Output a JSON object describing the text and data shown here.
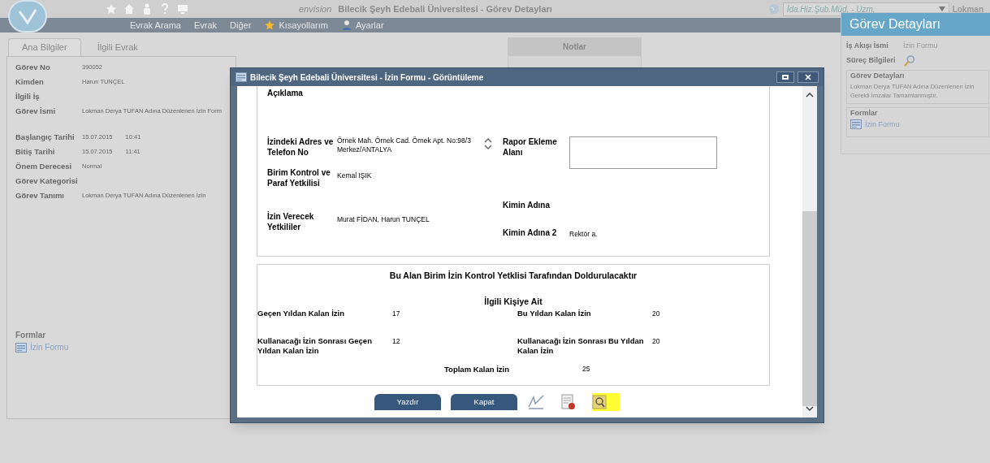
{
  "app": {
    "title": "Bilecik Şeyh Edebali Üniversitesi - Görev Detayları",
    "brand": "envision",
    "role": "İda.Hiz.Şub.Müd. - Uzm.",
    "user": "Lokman"
  },
  "menu": [
    {
      "label": "Evrak Arama",
      "kind": "plain"
    },
    {
      "label": "Evrak",
      "kind": "plain"
    },
    {
      "label": "Diğer",
      "kind": "plain"
    },
    {
      "label": "Kısayollarım",
      "kind": "star"
    },
    {
      "label": "Ayarlar",
      "kind": "user"
    }
  ],
  "tabs": [
    {
      "label": "Ana Bilgiler",
      "selected": true
    },
    {
      "label": "İlgili Evrak",
      "selected": false
    }
  ],
  "field_groups": [
    [
      {
        "label": "Görev No",
        "value": "390052"
      },
      {
        "label": "Kimden",
        "value": "Harun TUNÇEL"
      },
      {
        "label": "İlgili İş"
      },
      {
        "label": "Görev İsmi",
        "value": "Lokman Derya TUFAN Adına Düzenlenen İzin Form"
      }
    ],
    [
      {
        "label": "Başlangıç Tarihi",
        "value": "15.07.2015",
        "time": "10:41"
      },
      {
        "label": "Bitiş Tarihi",
        "value": "15.07.2015",
        "time": "11:41"
      },
      {
        "label": "Önem Derecesi",
        "value": "Normal"
      },
      {
        "label": "Görev Kategorisi"
      },
      {
        "label": "Görev Tanımı",
        "value": "Lokman Derya TUFAN Adına Düzenlenen İzin"
      }
    ]
  ],
  "forms": {
    "title": "Formlar",
    "items": [
      "İzin Formu"
    ]
  },
  "notes": {
    "title": "Notlar"
  },
  "side_panel": {
    "title": "Görev Detayları",
    "rows": [
      {
        "label": "İş Akışı İsmi",
        "kind": "text",
        "value": "İzin Formu"
      },
      {
        "label": "Süreç Bilgileri",
        "kind": "search"
      }
    ],
    "details": {
      "title": "Görev Detayları",
      "lines": [
        "Lokman Derya TUFAN Adına Düzenlenen İzin",
        "Gerekli İmzalar Tamamlanmıştır."
      ]
    },
    "forms": {
      "title": "Formlar",
      "items": [
        "İzin Formu"
      ]
    }
  },
  "modal": {
    "title": "Bilecik Şeyh Edebali Üniversitesi - İzin Formu - Görüntüleme",
    "left": [
      {
        "label": "Açıklama",
        "kind": "text"
      },
      {
        "label": "İzindeki Adres ve Telefon No",
        "kind": "scroll",
        "lines": [
          "Örnek Mah. Örnek Cad. Örnek Apt. No:98/3",
          "Merkez/ANTALYA"
        ]
      },
      {
        "label": "Birim Kontrol ve Paraf Yetkilisi",
        "kind": "text",
        "value": "Kemal IŞIK"
      },
      {
        "label": "İzin Verecek Yetkililer",
        "kind": "text",
        "value": "Murat FİDAN, Harun TUNÇEL"
      }
    ],
    "right": [
      {
        "label": "Rapor Ekleme Alanı",
        "kind": "upload"
      },
      {
        "label": "Kimin Adına",
        "kind": "text"
      },
      {
        "label": "Kimin Adına 2",
        "kind": "text",
        "value": "Rektör a."
      }
    ],
    "section": {
      "title": "Bu Alan Birim İzin Kontrol Yetklisi Tarafından Doldurulacaktır",
      "subtitle": "İlgili Kişiye Ait",
      "rows": [
        [
          {
            "label": "Geçen Yıldan Kalan İzin",
            "value": "17"
          },
          {
            "label": "Bu Yıldan Kalan İzin",
            "value": "20"
          }
        ],
        [
          {
            "label": "Kullanacağı İzin Sonrası Geçen Yıldan Kalan İzin",
            "value": "12"
          },
          {
            "label": "Kullanacağı İzin Sonrası Bu Yıldan Kalan İzin",
            "value": "20"
          }
        ]
      ],
      "total": {
        "label": "Toplam Kalan İzin",
        "value": "25"
      }
    },
    "buttons": [
      "Yazdır",
      "Kapat"
    ],
    "tools": [
      {
        "kind": "sign",
        "highlighted": false
      },
      {
        "kind": "seal",
        "highlighted": false
      },
      {
        "kind": "search",
        "highlighted": true
      }
    ]
  }
}
